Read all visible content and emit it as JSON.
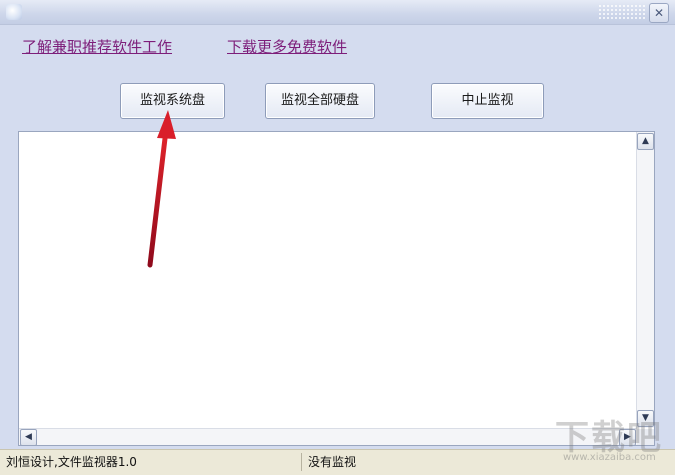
{
  "window": {
    "title": "",
    "close_label": "✕"
  },
  "links": {
    "part_time": "了解兼职推荐软件工作",
    "download_more": "下载更多免费软件"
  },
  "buttons": {
    "monitor_system": "监视系统盘",
    "monitor_all": "监视全部硬盘",
    "stop_monitor": "中止监视"
  },
  "output": {
    "content": ""
  },
  "scroll": {
    "up": "▲",
    "down": "▼",
    "left": "◀",
    "right": "▶"
  },
  "statusbar": {
    "author": "刘恒设计,文件监视器1.0",
    "state": "没有监视"
  },
  "watermark": {
    "main": "下载吧",
    "sub": "www.xiazaiba.com"
  },
  "colors": {
    "link": "#7d1e7a",
    "window_bg": "#d4dcef",
    "arrow": "#c8102e"
  },
  "icons": [
    "app-icon",
    "close-icon",
    "scroll-up-icon",
    "scroll-down-icon",
    "scroll-left-icon",
    "scroll-right-icon"
  ]
}
